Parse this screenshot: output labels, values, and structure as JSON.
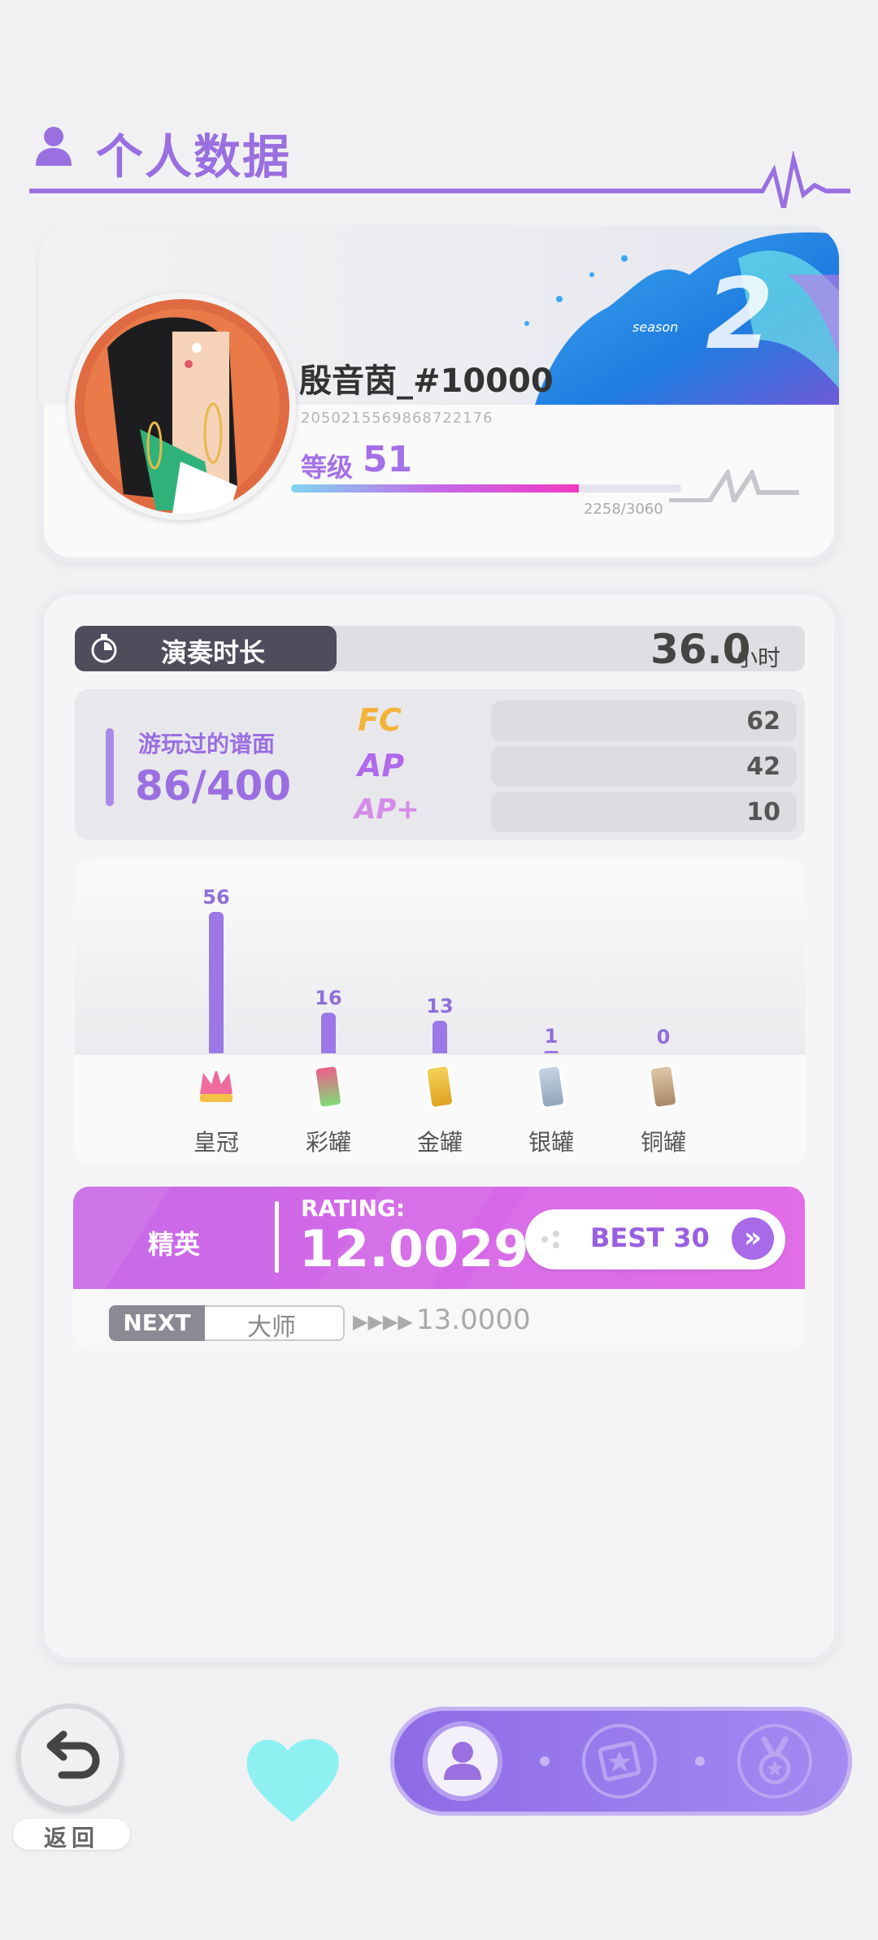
{
  "header": {
    "title": "个人数据",
    "icon": "person-icon"
  },
  "profile": {
    "name": "殷音茵_#10000",
    "id": "2050215569868722176",
    "level_label": "等级",
    "level": "51",
    "exp": "2258/3060",
    "exp_fraction": 0.738,
    "banner_text": "season",
    "banner_number": "2"
  },
  "stats": {
    "playtime_label": "演奏时长",
    "playtime_value": "36.0",
    "playtime_unit": "小时",
    "charts_label": "游玩过的谱面",
    "charts_value": "86/400",
    "badges": [
      {
        "label": "FC",
        "count": "62",
        "color": "#f2b33a"
      },
      {
        "label": "AP",
        "count": "42",
        "color": "#b06aea"
      },
      {
        "label": "AP+",
        "count": "10",
        "color": "#d48ce8"
      }
    ]
  },
  "distribution": [
    {
      "label": "皇冠",
      "count": "56",
      "value": 56,
      "icon": "crown-icon"
    },
    {
      "label": "彩罐",
      "count": "16",
      "value": 16,
      "icon": "rainbow-can-icon"
    },
    {
      "label": "金罐",
      "count": "13",
      "value": 13,
      "icon": "gold-can-icon"
    },
    {
      "label": "银罐",
      "count": "1",
      "value": 1,
      "icon": "silver-can-icon"
    },
    {
      "label": "铜罐",
      "count": "0",
      "value": 0,
      "icon": "bronze-can-icon"
    }
  ],
  "rating": {
    "tier": "精英",
    "label": "RATING:",
    "value": "12.0029",
    "best_button": "BEST 30",
    "next_tag": "NEXT",
    "next_tier": "大师",
    "next_arrows": "▶▶▶▶",
    "next_value": "13.0000"
  },
  "footer": {
    "back_label": "返回"
  },
  "colors": {
    "accent": "#9a6fe0",
    "rating": "#d668e6"
  }
}
